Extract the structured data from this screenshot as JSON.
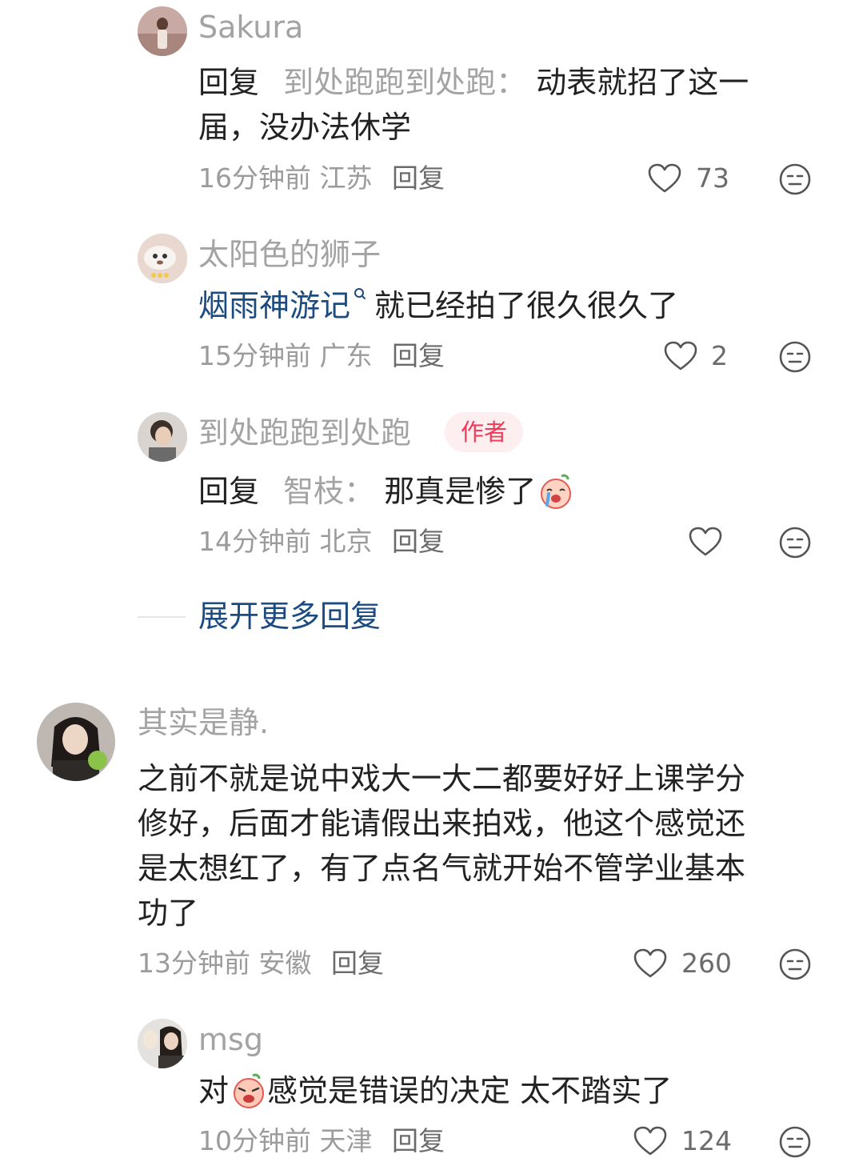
{
  "comments": [
    {
      "username": "Sakura",
      "reply_prefix": "回复",
      "reply_to": "到处跑跑到处跑：",
      "text_line1": "动表就招了这一",
      "text_line2": "届，没办法休学",
      "time": "16分钟前",
      "location": "江苏",
      "reply_label": "回复",
      "likes": "73"
    },
    {
      "username": "太阳色的狮子",
      "topic": "烟雨神游记",
      "text": "就已经拍了很久很久了",
      "time": "15分钟前",
      "location": "广东",
      "reply_label": "回复",
      "likes": "2"
    },
    {
      "username": "到处跑跑到处跑",
      "badge": "作者",
      "reply_prefix": "回复",
      "reply_to": "智枝：",
      "text": "那真是惨了",
      "time": "14分钟前",
      "location": "北京",
      "reply_label": "回复",
      "likes": ""
    },
    {
      "username": "其实是静.",
      "line1": "之前不就是说中戏大一大二都要好好上课学分",
      "line2": "修好，后面才能请假出来拍戏，他这个感觉还",
      "line3": "是太想红了，有了点名气就开始不管学业基本",
      "line4": "功了",
      "time": "13分钟前",
      "location": "安徽",
      "reply_label": "回复",
      "likes": "260"
    },
    {
      "username": "msg",
      "text_before": "对",
      "text_after": "感觉是错误的决定 太不踏实了",
      "time": "10分钟前",
      "location": "天津",
      "reply_label": "回复",
      "likes": "124"
    }
  ],
  "expand_more": "展开更多回复",
  "colors": {
    "username": "#a3a3a3",
    "body_text": "#222222",
    "link_blue": "#1b4b80",
    "author_badge_text": "#f23a57",
    "author_badge_bg": "#fdeef0"
  },
  "icons": {
    "like": "heart-outline-icon",
    "reaction": "neutral-face-icon",
    "emoji_crying": "crying-emoji",
    "emoji_upset": "upset-emoji",
    "topic_search": "search-icon"
  }
}
